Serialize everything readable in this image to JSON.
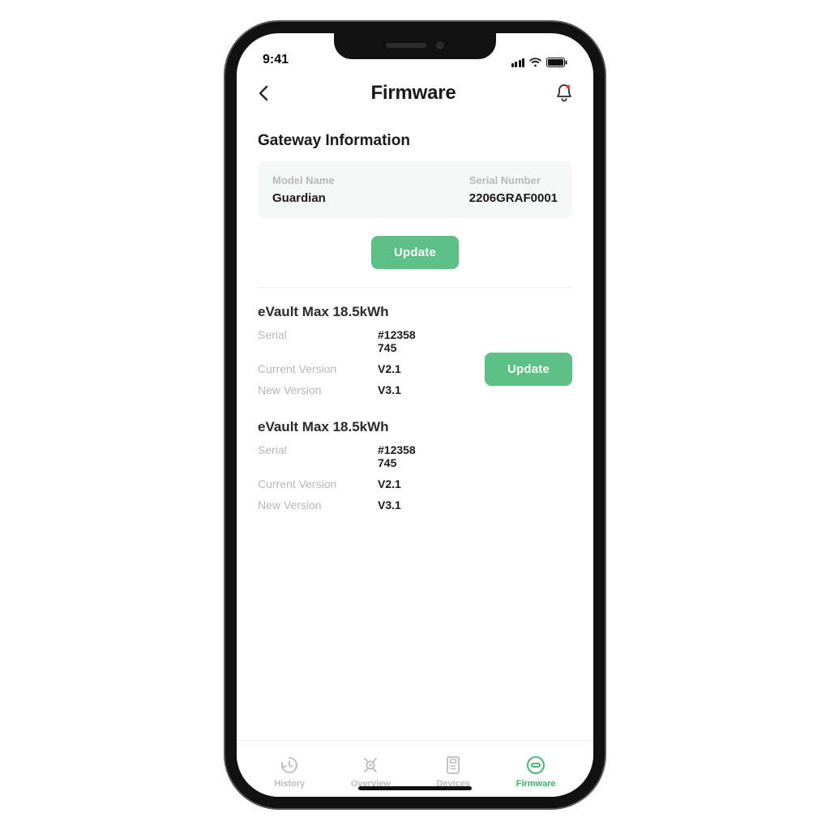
{
  "status": {
    "time": "9:41"
  },
  "header": {
    "title": "Firmware"
  },
  "gateway": {
    "heading": "Gateway Information",
    "model_label": "Model Name",
    "model_value": "Guardian",
    "serial_label": "Serial Number",
    "serial_value": "2206GRAF0001",
    "update_label": "Update"
  },
  "devices": [
    {
      "title": "eVault Max 18.5kWh",
      "serial_label": "Serial",
      "serial_value": "#12358",
      "serial_value2": "745",
      "current_label": "Current Version",
      "current_value": "V2.1",
      "new_label": "New Version",
      "new_value": "V3.1",
      "update_label": "Update",
      "show_update": true
    },
    {
      "title": "eVault Max 18.5kWh",
      "serial_label": "Serial",
      "serial_value": "#12358",
      "serial_value2": "745",
      "current_label": "Current Version",
      "current_value": "V2.1",
      "new_label": "New Version",
      "new_value": "V3.1",
      "show_update": false
    }
  ],
  "tabs": {
    "history": "History",
    "overview": "Overview",
    "devices": "Devices",
    "firmware": "Firmware"
  },
  "colors": {
    "accent": "#5bc184"
  }
}
